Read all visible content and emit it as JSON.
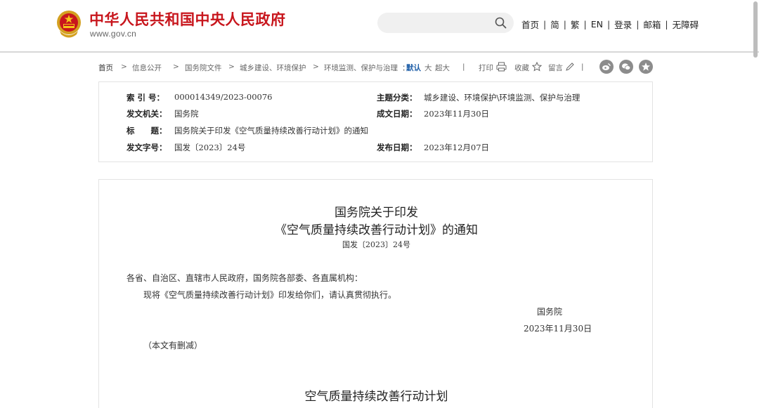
{
  "header": {
    "site_title": "中华人民共和国中央人民政府",
    "site_url": "www.gov.cn",
    "search": {
      "placeholder": ""
    },
    "nav": [
      "首页",
      "简",
      "繁",
      "EN",
      "登录",
      "邮箱",
      "无障碍"
    ]
  },
  "breadcrumb": {
    "items": [
      "首页",
      "信息公开",
      "国务院文件",
      "城乡建设、环境保护",
      "环境监测、保护与治理"
    ],
    "font_size_options": [
      "默认",
      "大",
      "超大"
    ],
    "tools": {
      "print": "打印",
      "favorite": "收藏",
      "comment": "留言"
    },
    "share_icons": [
      "weibo-icon",
      "wechat-icon",
      "qzone-icon"
    ]
  },
  "meta": {
    "index_label": "索 引 号：",
    "index_value": "000014349/2023-00076",
    "topic_label": "主题分类：",
    "topic_value": "城乡建设、环境保护\\环境监测、保护与治理",
    "issuer_label": "发文机关：",
    "issuer_value": "国务院",
    "written_date_label": "成文日期：",
    "written_date_value": "2023年11月30日",
    "title_label": "标　　题：",
    "title_value": "国务院关于印发《空气质量持续改善行动计划》的通知",
    "doc_no_label": "发文字号：",
    "doc_no_value": "国发〔2023〕24号",
    "publish_date_label": "发布日期：",
    "publish_date_value": "2023年12月07日"
  },
  "document": {
    "title_line1": "国务院关于印发",
    "title_line2": "《空气质量持续改善行动计划》的通知",
    "doc_number": "国发〔2023〕24号",
    "addressee": "各省、自治区、直辖市人民政府，国务院各部委、各直属机构：",
    "body": "现将《空气质量持续改善行动计划》印发给你们，请认真贯彻执行。",
    "signature": "国务院",
    "date": "2023年11月30日",
    "note": "（本文有删减）",
    "plan_title": "空气质量持续改善行动计划"
  },
  "colors": {
    "brand_red": "#c8161d",
    "link_blue": "#1f5fa8"
  }
}
